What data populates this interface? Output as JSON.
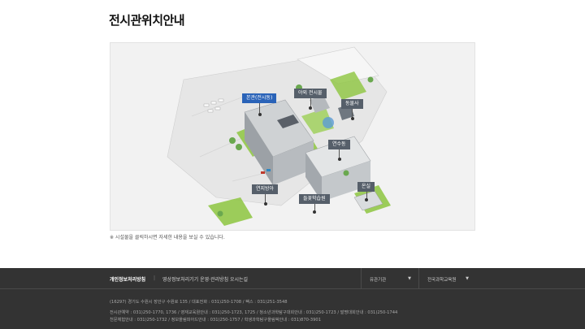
{
  "page": {
    "title": "전시관위치안내"
  },
  "map": {
    "tags": [
      {
        "id": "main",
        "label": "본관(전시동)",
        "active": true
      },
      {
        "id": "outdoor",
        "label": "야외 전시물",
        "active": false
      },
      {
        "id": "zoo",
        "label": "동물사",
        "active": false
      },
      {
        "id": "training",
        "label": "연수동",
        "active": false
      },
      {
        "id": "natural",
        "label": "연지방아",
        "active": false
      },
      {
        "id": "flower",
        "label": "들꽃학습원",
        "active": false
      },
      {
        "id": "greenhouse",
        "label": "온실",
        "active": false
      }
    ]
  },
  "note": "※ 시설물을 클릭하시면 자세한 내용을 보실 수 있습니다.",
  "footer": {
    "links": [
      "개인정보처리방침",
      "영상정보처리기기 운영·관리방침",
      "오시는길"
    ],
    "dropdowns": [
      "유관기관",
      "전국과학교육원"
    ],
    "address": "(16297) 경기도 수원시 장안구 수원로 135 / 대표전화 : 031)250-1708 / 팩스 : 031)251-3548",
    "contacts1": "전시관예약 : 031)250-1770, 1736 / 영재교육원안내 : 031)250-1723, 1725 / 청소년과학탐구대회안내 : 031)250-1723 / 발명대회안내 : 031)250-1744",
    "contacts2": "천문체험안내 : 031)250-1732 / 정보올림피아드안내 : 031)250-1757 / 학생과학탐구올림픽안내 : 031)870-3901"
  }
}
